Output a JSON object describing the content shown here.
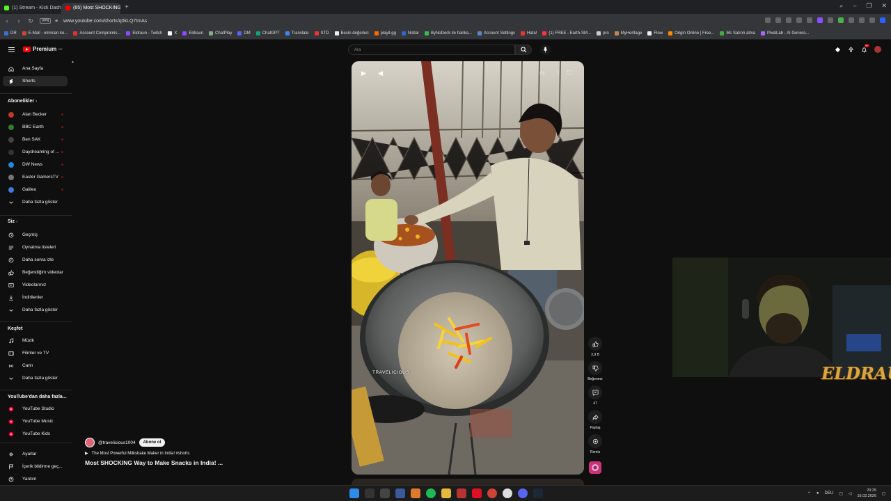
{
  "browser": {
    "tabs": [
      {
        "label": "(1) Stream - Kick Dashbo...",
        "color": "#53fc18"
      },
      {
        "label": "(65) Most SHOCKING W...",
        "color": "#ff0000",
        "active": true
      }
    ],
    "url": "www.youtube.com/shorts/q0kLQ7tmAs",
    "vpn_label": "VPN",
    "bookmarks": [
      "DR",
      "E-Mail - emircan ko...",
      "Account Compromis...",
      "Eldraun - Twitch",
      "X",
      "Eldraun",
      "ChatPlay",
      "DM",
      "ChatGPT",
      "Translate",
      "STD",
      "Besin değerleri",
      "playit.gg",
      "Notlar",
      "ByNoDeck ile harika...",
      "Account Settings",
      "Hata!",
      "(1) FREE - Earth-SM...",
      "pro",
      "MyHeritage",
      "Flow",
      "Origin Online | Free...",
      "Mc Satınn alma",
      "PixelLab - AI Genera..."
    ]
  },
  "youtube": {
    "logo_text": "Premium",
    "logo_region": "DE",
    "search_placeholder": "Ara",
    "notif_count": "9+"
  },
  "sidebar": {
    "main": [
      {
        "label": "Ana Sayfa",
        "icon": "home-icon"
      },
      {
        "label": "Shorts",
        "icon": "shorts-icon",
        "active": true
      }
    ],
    "subs_header": "Abonelikler",
    "subs": [
      {
        "label": "Alan Becker",
        "color": "#c0392b"
      },
      {
        "label": "BBC Earth",
        "color": "#2e7d32"
      },
      {
        "label": "Ben SAK",
        "color": "#444444"
      },
      {
        "label": "Daydreaming of ...",
        "color": "#333333"
      },
      {
        "label": "DW News",
        "color": "#1e88e5"
      },
      {
        "label": "Easter GamersTV",
        "color": "#777777"
      },
      {
        "label": "Galileo",
        "color": "#3a7bd5"
      }
    ],
    "subs_more": "Daha fazla göster",
    "you_header": "Siz",
    "you": [
      {
        "label": "Geçmiş",
        "icon": "history-icon"
      },
      {
        "label": "Oynatma listeleri",
        "icon": "playlist-icon"
      },
      {
        "label": "Daha sonra izle",
        "icon": "clock-icon"
      },
      {
        "label": "Beğendiğim videolar",
        "icon": "like-icon"
      },
      {
        "label": "Videolarınız",
        "icon": "video-icon"
      },
      {
        "label": "İndirilenler",
        "icon": "download-icon"
      }
    ],
    "you_more": "Daha fazla göster",
    "explore_header": "Keşfet",
    "explore": [
      {
        "label": "Müzik",
        "icon": "music-icon"
      },
      {
        "label": "Filmler ve TV",
        "icon": "film-icon"
      },
      {
        "label": "Canlı",
        "icon": "live-icon"
      }
    ],
    "explore_more": "Daha fazla göster",
    "more_header": "YouTube'dan daha fazla...",
    "more": [
      {
        "label": "YouTube Studio"
      },
      {
        "label": "YouTube Music"
      },
      {
        "label": "YouTube Kids"
      }
    ],
    "bottom": [
      {
        "label": "Ayarlar",
        "icon": "settings-icon"
      },
      {
        "label": "İçerik bildirme geç...",
        "icon": "flag-icon"
      },
      {
        "label": "Yardım",
        "icon": "help-icon"
      }
    ]
  },
  "short": {
    "watermark": "TRAVELICIOUS",
    "likes": "3,9 B",
    "dislike_label": "Beğenme",
    "comments": "47",
    "share_label": "Paylaş",
    "remix_label": "Remix",
    "channel": "@travelicious1004",
    "subscribe_label": "Abone ol",
    "related": "The Most Powerful Milkshake Maker in India! #shorts",
    "title": "Most SHOCKING Way to Make Snacks in India! ..."
  },
  "stream": {
    "brand": "ELDRAUN"
  },
  "taskbar": {
    "lang": "DEU",
    "time": "20:25",
    "date": "16.02.2026"
  }
}
